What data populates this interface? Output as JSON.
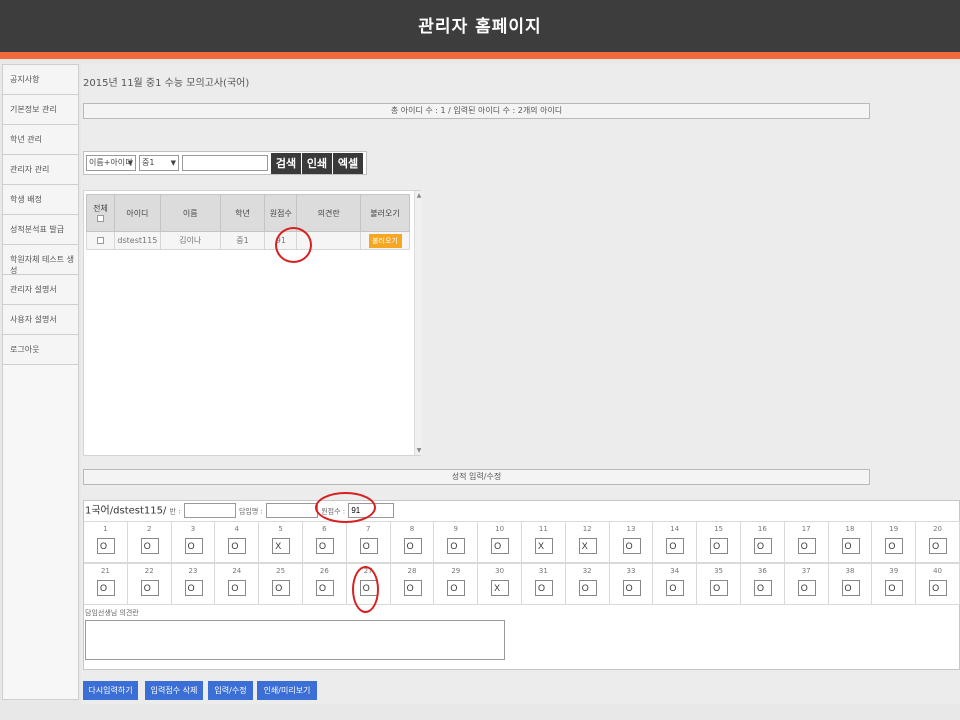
{
  "header": {
    "title": "관리자 홈페이지"
  },
  "sidebar": {
    "items": [
      "공지사항",
      "기본정보 관리",
      "학년 관리",
      "관리자 관리",
      "학생 배정",
      "성적분석표 발급",
      "학원자체 테스트 생성",
      "관리자 설명서",
      "사용자 설명서",
      "로그아웃"
    ]
  },
  "page_title": "2015년 11월 중1 수능 모의고사(국어)",
  "summary": "총 아이디 수 : 1 / 입력된 아이디 수 : 2개의 아이디",
  "search": {
    "type_select": "이름+아이디",
    "grade_select": "중1",
    "query": "",
    "search_btn": "검색",
    "print_btn": "인쇄",
    "excel_btn": "엑셀"
  },
  "table": {
    "headers": {
      "all": "전체",
      "id": "아이디",
      "name": "이름",
      "grade": "학년",
      "raw": "원점수",
      "opinion": "의견란",
      "load": "불러오기"
    },
    "rows": [
      {
        "id": "dstest115",
        "name": "김이나",
        "grade": "중1",
        "raw": "91",
        "opinion": "",
        "load": "불러오기"
      }
    ]
  },
  "score_bar": "성적 입력/수정",
  "score": {
    "student": "1국어/dstest115/",
    "class_label": "반 :",
    "class_value": "",
    "teacher_label": "담임명 :",
    "teacher_value": "",
    "raw_label": "원점수 :",
    "raw_value": "91",
    "row1": [
      {
        "n": "1",
        "v": "O"
      },
      {
        "n": "2",
        "v": "O"
      },
      {
        "n": "3",
        "v": "O"
      },
      {
        "n": "4",
        "v": "O"
      },
      {
        "n": "5",
        "v": "X"
      },
      {
        "n": "6",
        "v": "O"
      },
      {
        "n": "7",
        "v": "O"
      },
      {
        "n": "8",
        "v": "O"
      },
      {
        "n": "9",
        "v": "O"
      },
      {
        "n": "10",
        "v": "O"
      },
      {
        "n": "11",
        "v": "X"
      },
      {
        "n": "12",
        "v": "X"
      },
      {
        "n": "13",
        "v": "O"
      },
      {
        "n": "14",
        "v": "O"
      },
      {
        "n": "15",
        "v": "O"
      },
      {
        "n": "16",
        "v": "O"
      },
      {
        "n": "17",
        "v": "O"
      },
      {
        "n": "18",
        "v": "O"
      },
      {
        "n": "19",
        "v": "O"
      },
      {
        "n": "20",
        "v": "O"
      }
    ],
    "row2": [
      {
        "n": "21",
        "v": "O"
      },
      {
        "n": "22",
        "v": "O"
      },
      {
        "n": "23",
        "v": "O"
      },
      {
        "n": "24",
        "v": "O"
      },
      {
        "n": "25",
        "v": "O"
      },
      {
        "n": "26",
        "v": "O"
      },
      {
        "n": "27",
        "v": "O"
      },
      {
        "n": "28",
        "v": "O"
      },
      {
        "n": "29",
        "v": "O"
      },
      {
        "n": "30",
        "v": "X"
      },
      {
        "n": "31",
        "v": "O"
      },
      {
        "n": "32",
        "v": "O"
      },
      {
        "n": "33",
        "v": "O"
      },
      {
        "n": "34",
        "v": "O"
      },
      {
        "n": "35",
        "v": "O"
      },
      {
        "n": "36",
        "v": "O"
      },
      {
        "n": "37",
        "v": "O"
      },
      {
        "n": "38",
        "v": "O"
      },
      {
        "n": "39",
        "v": "O"
      },
      {
        "n": "40",
        "v": "O"
      }
    ],
    "comment_label": "담임선생님 의견란",
    "comment_value": ""
  },
  "buttons": {
    "reenter": "다시입력하기",
    "delete": "입력점수 삭제",
    "save": "입력/수정",
    "print": "인쇄/미리보기"
  },
  "colors": {
    "header": "#3d3d3d",
    "accent": "#f26a3b",
    "button_blue": "#3b6fd6",
    "load_orange": "#f5a623",
    "annotation_red": "#d82020"
  }
}
